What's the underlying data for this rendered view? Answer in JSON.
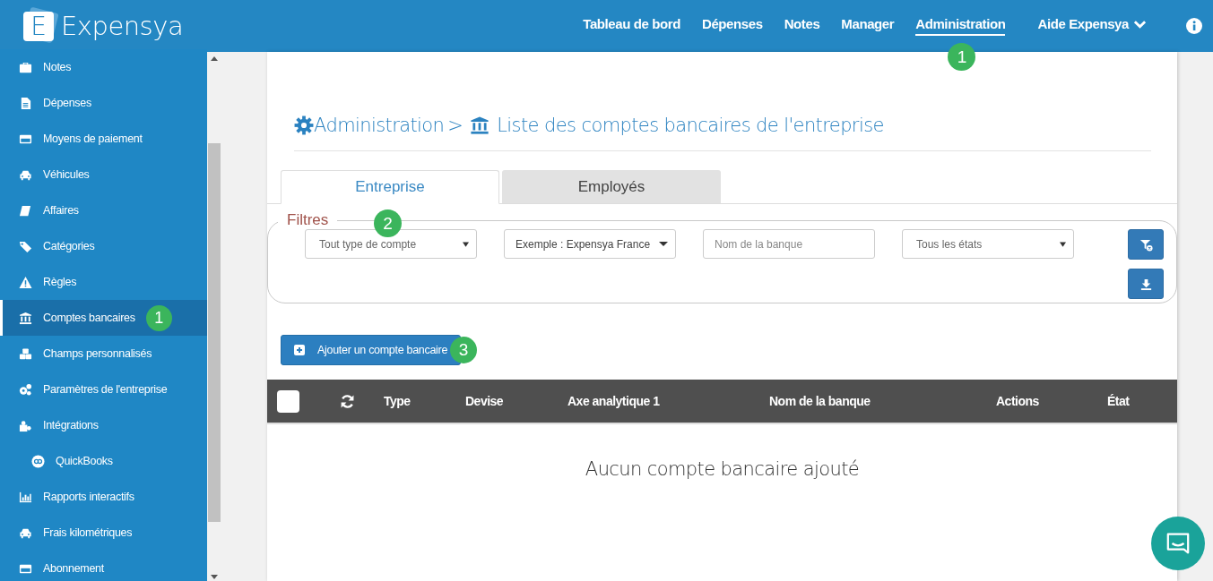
{
  "header": {
    "logo_letter": "E",
    "brand": "Expensya",
    "nav": [
      {
        "label": "Tableau de bord",
        "selected": false
      },
      {
        "label": "Dépenses",
        "selected": false
      },
      {
        "label": "Notes",
        "selected": false
      },
      {
        "label": "Manager",
        "selected": false
      },
      {
        "label": "Administration",
        "selected": true,
        "badge": "1"
      }
    ],
    "help": {
      "label": "Aide Expensya"
    }
  },
  "sidebar": {
    "items": [
      {
        "label": "Notes",
        "selected": false
      },
      {
        "label": "Dépenses",
        "selected": false
      },
      {
        "label": "Moyens de paiement",
        "selected": false
      },
      {
        "label": "Véhicules",
        "selected": false
      },
      {
        "label": "Affaires",
        "selected": false
      },
      {
        "label": "Catégories",
        "selected": false
      },
      {
        "label": "Règles",
        "selected": false
      },
      {
        "label": "Comptes bancaires",
        "selected": true,
        "badge": "1"
      },
      {
        "label": "Champs personnalisés",
        "selected": false
      },
      {
        "label": "Paramètres de l'entreprise",
        "selected": false
      },
      {
        "label": "Intégrations",
        "selected": false,
        "children": [
          {
            "label": "QuickBooks",
            "selected": false
          }
        ]
      },
      {
        "label": "Rapports interactifs",
        "selected": false
      },
      {
        "label": "Frais kilométriques",
        "selected": false
      },
      {
        "label": "Abonnement",
        "selected": false
      }
    ]
  },
  "breadcrumb": {
    "parent": "Administration",
    "separator": ">",
    "current": "Liste des comptes bancaires de l'entreprise"
  },
  "tabs": [
    {
      "label": "Entreprise",
      "selected": true
    },
    {
      "label": "Employés",
      "selected": false
    }
  ],
  "filters": {
    "legend": "Filtres",
    "badge": "2",
    "fields": [
      {
        "kind": "select",
        "value": "Tout type de compte"
      },
      {
        "kind": "dropdown",
        "value": "Exemple : Expensya France"
      },
      {
        "kind": "input",
        "placeholder": "Nom de la banque"
      },
      {
        "kind": "select",
        "value": "Tous les états"
      }
    ]
  },
  "add_button": {
    "label": "Ajouter un compte bancaire",
    "badge": "3"
  },
  "table": {
    "select_all": {
      "checked": false
    },
    "columns": [
      "Type",
      "Devise",
      "Axe analytique 1",
      "Nom de la banque",
      "Actions",
      "État"
    ],
    "empty_message": "Aucun compte bancaire ajouté"
  }
}
